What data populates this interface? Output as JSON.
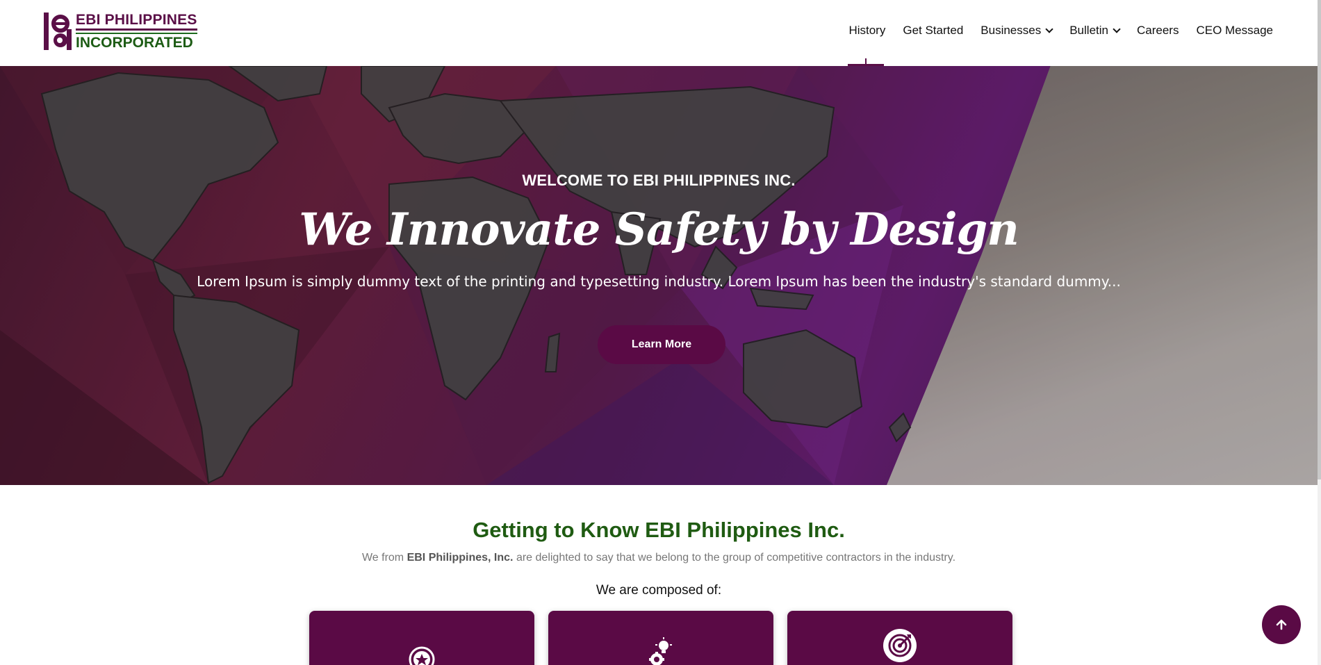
{
  "header": {
    "logo": {
      "line1": "EBI PHILIPPINES",
      "line2": "INCORPORATED"
    },
    "nav": [
      {
        "label": "History",
        "dropdown": false,
        "active": true
      },
      {
        "label": "Get Started",
        "dropdown": false
      },
      {
        "label": "Businesses",
        "dropdown": true
      },
      {
        "label": "Bulletin",
        "dropdown": true
      },
      {
        "label": "Careers",
        "dropdown": false
      },
      {
        "label": "CEO Message",
        "dropdown": false
      }
    ]
  },
  "hero": {
    "kicker": "WELCOME TO EBI PHILIPPINES INC.",
    "title": "We Innovate Safety by Design",
    "subtitle": "Lorem Ipsum is simply dummy text of the printing and typesetting industry. Lorem Ipsum has been the industry's standard dummy...",
    "button": "Learn More"
  },
  "about": {
    "title": "Getting to Know EBI Philippines Inc.",
    "desc_prefix": "We from ",
    "desc_bold": "EBI Philippines, Inc.",
    "desc_suffix": " are delighted to say that we belong to the group of competitive contractors in the industry.",
    "composed_label": "We are composed of:"
  },
  "cards": [
    {
      "icon": "star-badge-icon"
    },
    {
      "icon": "bulb-gear-icon"
    },
    {
      "icon": "target-icon"
    }
  ],
  "colors": {
    "brand_purple": "#5a0a45",
    "brand_green": "#1f5b12"
  },
  "scroll_top_icon": "arrow-up-icon"
}
